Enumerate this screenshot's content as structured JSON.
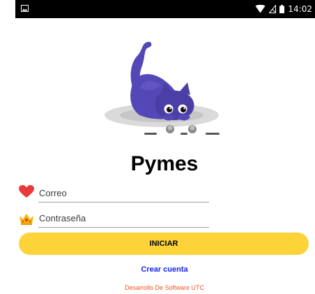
{
  "status_bar": {
    "time": "14:02",
    "icons": [
      "image-icon",
      "wifi-icon",
      "no-signal-icon",
      "battery-icon"
    ]
  },
  "hero": {
    "image": "purple-cat-illustration"
  },
  "app": {
    "title": "Pymes"
  },
  "form": {
    "email": {
      "placeholder": "Correo",
      "value": "",
      "icon": "heart-icon",
      "icon_color": "#e83a3a"
    },
    "password": {
      "placeholder": "Contraseña",
      "value": "",
      "icon": "crown-icon",
      "icon_color": "#f4b400"
    },
    "submit_label": "INICIAR"
  },
  "links": {
    "create_account": "Crear cuenta"
  },
  "footer": {
    "credit": "Desarrollo De Software  UTC"
  },
  "colors": {
    "button": "#fdd33a",
    "link": "#1424ff",
    "footer": "#f0541e",
    "cat": "#5348b5"
  }
}
